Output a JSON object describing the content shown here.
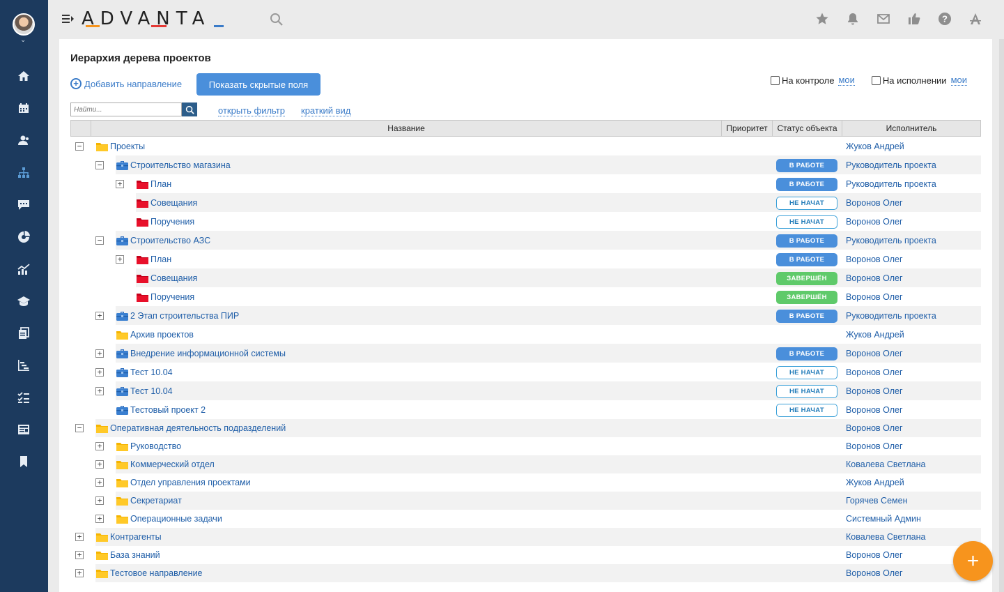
{
  "app": {
    "logo_text": "ADVANTA",
    "brand_colors": {
      "sidebar": "#1c3a5e",
      "accent": "#4a8fdb",
      "fab": "#f7941d"
    }
  },
  "sidebar": {
    "items": [
      {
        "icon": "home-icon"
      },
      {
        "icon": "calendar-icon"
      },
      {
        "icon": "contacts-icon"
      },
      {
        "icon": "hierarchy-icon",
        "active": true
      },
      {
        "icon": "chat-icon"
      },
      {
        "icon": "pie-chart-icon"
      },
      {
        "icon": "analytics-icon"
      },
      {
        "icon": "education-icon"
      },
      {
        "icon": "documents-icon"
      },
      {
        "icon": "gantt-icon"
      },
      {
        "icon": "checklist-icon"
      },
      {
        "icon": "news-icon"
      },
      {
        "icon": "bookmark-icon"
      }
    ]
  },
  "topbar": {
    "icons": [
      "star-icon",
      "bell-icon",
      "mail-icon",
      "thumbs-up-icon",
      "help-icon",
      "language-icon"
    ]
  },
  "page": {
    "title": "Иерархия дерева проектов",
    "add_direction": "Добавить направление",
    "show_hidden_button": "Показать скрытые поля",
    "on_control_label": "На контроле",
    "on_control_mine": "мои",
    "in_progress_label": "На исполнении",
    "in_progress_mine": "мои",
    "search_placeholder": "Найти...",
    "open_filter": "открыть фильтр",
    "short_view": "краткий вид"
  },
  "table": {
    "columns": {
      "name": "Название",
      "priority": "Приоритет",
      "status": "Статус объекта",
      "executor": "Исполнитель"
    },
    "rows": [
      {
        "level": 0,
        "expander": "minus",
        "icon": "folder-yellow",
        "name": "Проекты",
        "status": "",
        "executor": "Жуков Андрей",
        "alt": false
      },
      {
        "level": 1,
        "expander": "minus",
        "icon": "briefcase",
        "name": "Строительство магазина",
        "status": "В РАБОТЕ",
        "status_type": "work",
        "executor": "Руководитель проекта",
        "alt": true
      },
      {
        "level": 2,
        "expander": "plus",
        "icon": "folder-red",
        "name": "План",
        "status": "В РАБОТЕ",
        "status_type": "work",
        "executor": "Руководитель проекта",
        "alt": false
      },
      {
        "level": 2,
        "expander": "none",
        "icon": "folder-red",
        "name": "Совещания",
        "status": "НЕ НАЧАТ",
        "status_type": "new",
        "executor": "Воронов Олег",
        "alt": true
      },
      {
        "level": 2,
        "expander": "none",
        "icon": "folder-red",
        "name": "Поручения",
        "status": "НЕ НАЧАТ",
        "status_type": "new",
        "executor": "Воронов Олег",
        "alt": false
      },
      {
        "level": 1,
        "expander": "minus",
        "icon": "briefcase",
        "name": "Строительство АЗС",
        "status": "В РАБОТЕ",
        "status_type": "work",
        "executor": "Руководитель проекта",
        "alt": true
      },
      {
        "level": 2,
        "expander": "plus",
        "icon": "folder-red",
        "name": "План",
        "status": "В РАБОТЕ",
        "status_type": "work",
        "executor": "Воронов Олег",
        "alt": false
      },
      {
        "level": 2,
        "expander": "none",
        "icon": "folder-red",
        "name": "Совещания",
        "status": "ЗАВЕРШЁН",
        "status_type": "done",
        "executor": "Воронов Олег",
        "alt": true
      },
      {
        "level": 2,
        "expander": "none",
        "icon": "folder-red",
        "name": "Поручения",
        "status": "ЗАВЕРШЁН",
        "status_type": "done",
        "executor": "Воронов Олег",
        "alt": false
      },
      {
        "level": 1,
        "expander": "plus",
        "icon": "briefcase",
        "name": "2 Этап строительства ПИР",
        "status": "В РАБОТЕ",
        "status_type": "work",
        "executor": "Руководитель проекта",
        "alt": true
      },
      {
        "level": 1,
        "expander": "none",
        "icon": "folder-yellow",
        "name": "Архив проектов",
        "status": "",
        "executor": "Жуков Андрей",
        "alt": false
      },
      {
        "level": 1,
        "expander": "plus",
        "icon": "briefcase",
        "name": "Внедрение информационной системы",
        "status": "В РАБОТЕ",
        "status_type": "work",
        "executor": "Воронов Олег",
        "alt": true
      },
      {
        "level": 1,
        "expander": "plus",
        "icon": "briefcase",
        "name": "Тест 10.04",
        "status": "НЕ НАЧАТ",
        "status_type": "new",
        "executor": "Воронов Олег",
        "alt": false
      },
      {
        "level": 1,
        "expander": "plus",
        "icon": "briefcase",
        "name": "Тест 10.04",
        "status": "НЕ НАЧАТ",
        "status_type": "new",
        "executor": "Воронов Олег",
        "alt": true
      },
      {
        "level": 1,
        "expander": "none",
        "icon": "briefcase",
        "name": "Тестовый проект 2",
        "status": "НЕ НАЧАТ",
        "status_type": "new",
        "executor": "Воронов Олег",
        "alt": false
      },
      {
        "level": 0,
        "expander": "minus",
        "icon": "folder-yellow",
        "name": "Оперативная деятельность подразделений",
        "status": "",
        "executor": "Воронов Олег",
        "alt": true
      },
      {
        "level": 1,
        "expander": "plus",
        "icon": "folder-yellow",
        "name": "Руководство",
        "status": "",
        "executor": "Воронов Олег",
        "alt": false
      },
      {
        "level": 1,
        "expander": "plus",
        "icon": "folder-yellow",
        "name": "Коммерческий отдел",
        "status": "",
        "executor": "Ковалева Светлана",
        "alt": true
      },
      {
        "level": 1,
        "expander": "plus",
        "icon": "folder-yellow",
        "name": "Отдел управления проектами",
        "status": "",
        "executor": "Жуков Андрей",
        "alt": false
      },
      {
        "level": 1,
        "expander": "plus",
        "icon": "folder-yellow",
        "name": "Секретариат",
        "status": "",
        "executor": "Горячев Семен",
        "alt": true
      },
      {
        "level": 1,
        "expander": "plus",
        "icon": "folder-yellow",
        "name": "Операционные задачи",
        "status": "",
        "executor": "Системный Админ",
        "alt": false
      },
      {
        "level": 0,
        "expander": "plus",
        "icon": "folder-yellow",
        "name": "Контрагенты",
        "status": "",
        "executor": "Ковалева Светлана",
        "alt": true
      },
      {
        "level": 0,
        "expander": "plus",
        "icon": "folder-yellow",
        "name": "База знаний",
        "status": "",
        "executor": "Воронов Олег",
        "alt": false
      },
      {
        "level": 0,
        "expander": "plus",
        "icon": "folder-yellow",
        "name": "Тестовое направление",
        "status": "",
        "executor": "Воронов Олег",
        "alt": true
      }
    ]
  },
  "fab": {
    "icon": "plus-icon",
    "label": "+"
  }
}
